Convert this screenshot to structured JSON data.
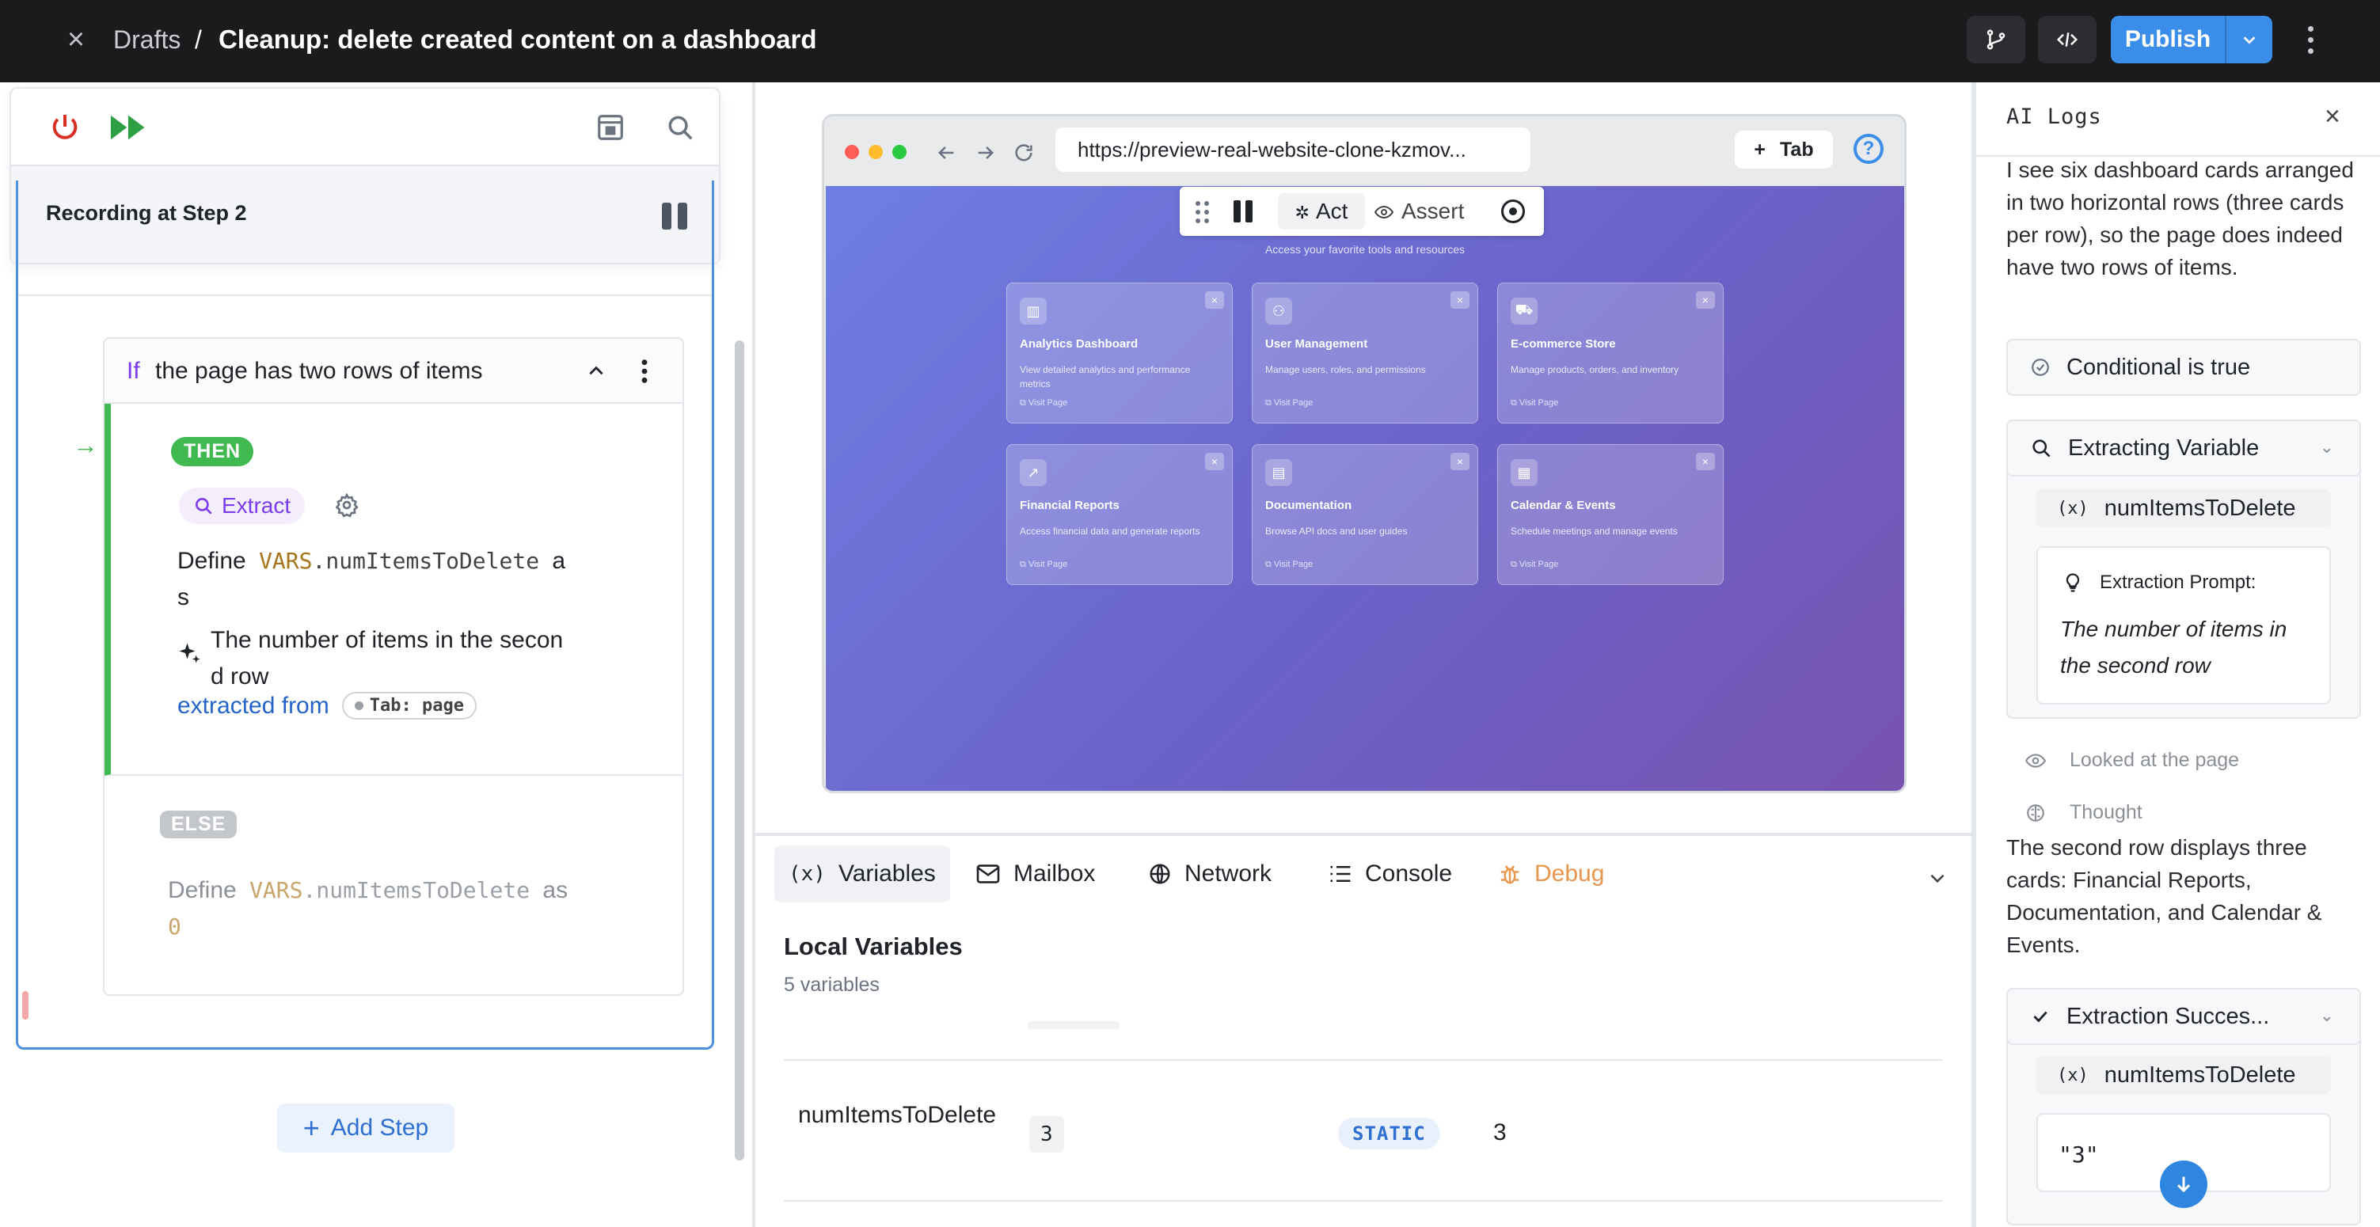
{
  "header": {
    "close_label": "×",
    "breadcrumb": "Drafts",
    "separator": "/",
    "title": "Cleanup: delete created content on a dashboard",
    "publish_label": "Publish"
  },
  "recorder": {
    "status": "Recording at Step 2"
  },
  "if_block": {
    "keyword": "If",
    "condition": "the page has two rows of items",
    "then_badge": "THEN",
    "action_type": "Extract",
    "define_prefix": "Define",
    "var_ns": "VARS",
    "var_name": ".numItemsToDelete",
    "define_suffix": "a",
    "define_suffix2": "s",
    "prompt_line1": "The number of items in the secon",
    "prompt_line2": "d row",
    "extracted_from": "extracted from",
    "tab_tag": "Tab: page",
    "else_badge": "ELSE",
    "else_define": "Define",
    "else_var_ns": "VARS",
    "else_var_name": ".numItemsToDelete",
    "else_as": "as",
    "else_value": "0"
  },
  "add_step_label": "Add Step",
  "browser": {
    "url": "https://preview-real-website-clone-kzmov...",
    "tab_button": "Tab",
    "help": "?",
    "page_subtitle": "Access your favorite tools and resources",
    "cards": [
      {
        "title": "Analytics Dashboard",
        "desc": "View detailed analytics and performance metrics",
        "link": "Visit Page",
        "icon": "chart-icon"
      },
      {
        "title": "User Management",
        "desc": "Manage users, roles, and permissions",
        "link": "Visit Page",
        "icon": "users-icon"
      },
      {
        "title": "E-commerce Store",
        "desc": "Manage products, orders, and inventory",
        "link": "Visit Page",
        "icon": "cart-icon"
      },
      {
        "title": "Financial Reports",
        "desc": "Access financial data and generate reports",
        "link": "Visit Page",
        "icon": "trend-icon"
      },
      {
        "title": "Documentation",
        "desc": "Browse API docs and user guides",
        "link": "Visit Page",
        "icon": "doc-icon"
      },
      {
        "title": "Calendar & Events",
        "desc": "Schedule meetings and manage events",
        "link": "Visit Page",
        "icon": "calendar-icon"
      }
    ],
    "card_close": "×"
  },
  "agent_toolbar": {
    "act": "Act",
    "assert": "Assert"
  },
  "bottom_tabs": {
    "variables": "Variables",
    "mailbox": "Mailbox",
    "network": "Network",
    "console": "Console",
    "debug": "Debug"
  },
  "local_vars": {
    "title": "Local Variables",
    "count": "5 variables",
    "rows": [
      {
        "name": "numItemsToDelete",
        "value": "3",
        "type": "STATIC",
        "resolved": "3"
      }
    ]
  },
  "ai_logs": {
    "title": "AI Logs",
    "intro": "I see six dashboard cards arranged in two horizontal rows (three cards per row), so the page does indeed have two rows of items.",
    "conditional": "Conditional is true",
    "extracting": "Extracting Variable",
    "var_name": "numItemsToDelete",
    "prompt_header": "Extraction Prompt:",
    "prompt_text": "The number of items in the second row",
    "looked": "Looked at the page",
    "thought": "Thought",
    "thought_text": "The second row displays three cards: Financial Reports, Documentation, and Calendar & Events.",
    "success": "Extraction Succes...",
    "result_var": "numItemsToDelete",
    "result_value": "\"3\""
  },
  "colors": {
    "accent": "#3a8de8",
    "then_green": "#3fb950",
    "extract_purple": "#7c3aed",
    "var_gold": "#a6741b",
    "topbar_bg": "#1b1b1d"
  }
}
